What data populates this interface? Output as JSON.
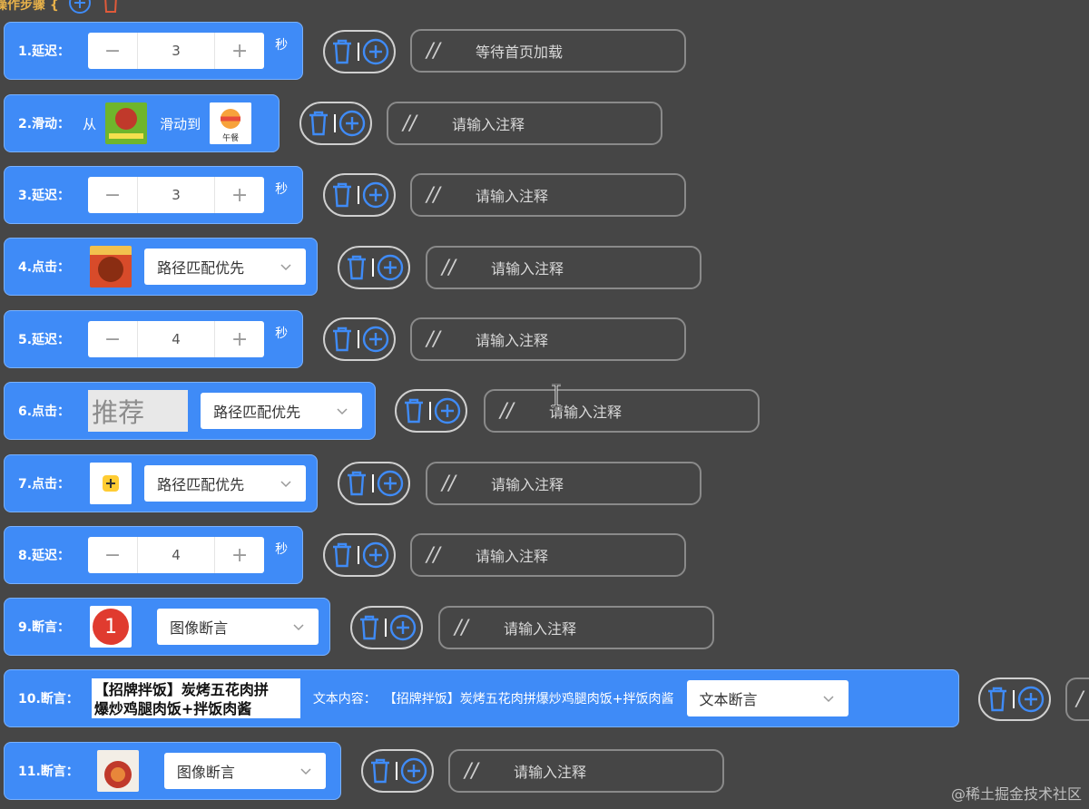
{
  "header": {
    "title": "操作步骤 {"
  },
  "steps": [
    {
      "label": "1.延迟：",
      "value": "3",
      "unit": "秒",
      "note": "等待首页加载"
    },
    {
      "label": "2.滑动：",
      "from": "从",
      "to": "滑动到",
      "to_caption": "午餐",
      "note": "请输入注释"
    },
    {
      "label": "3.延迟：",
      "value": "3",
      "unit": "秒",
      "note": "请输入注释"
    },
    {
      "label": "4.点击：",
      "select": "路径匹配优先",
      "note": "请输入注释"
    },
    {
      "label": "5.延迟：",
      "value": "4",
      "unit": "秒",
      "note": "请输入注释"
    },
    {
      "label": "6.点击：",
      "thumb_text": "推荐",
      "select": "路径匹配优先",
      "note": "请输入注释"
    },
    {
      "label": "7.点击：",
      "select": "路径匹配优先",
      "note": "请输入注释"
    },
    {
      "label": "8.延迟：",
      "value": "4",
      "unit": "秒",
      "note": "请输入注释"
    },
    {
      "label": "9.断言：",
      "thumb_text": "1",
      "select": "图像断言",
      "note": "请输入注释"
    },
    {
      "label": "10.断言：",
      "box_line1": "【招牌拌饭】炭烤五花肉拼",
      "box_line2": "爆炒鸡腿肉饭+拌饭肉酱",
      "content_label": "文本内容：",
      "content_value": "【招牌拌饭】炭烤五花肉拼爆炒鸡腿肉饭+拌饭肉酱",
      "select": "文本断言",
      "note_partial": "/"
    },
    {
      "label": "11.断言：",
      "select": "图像断言",
      "note": "请输入注释"
    }
  ],
  "common": {
    "minus": "−",
    "plus": "+",
    "slashes": "//"
  },
  "watermark": "@稀土掘金技术社区"
}
